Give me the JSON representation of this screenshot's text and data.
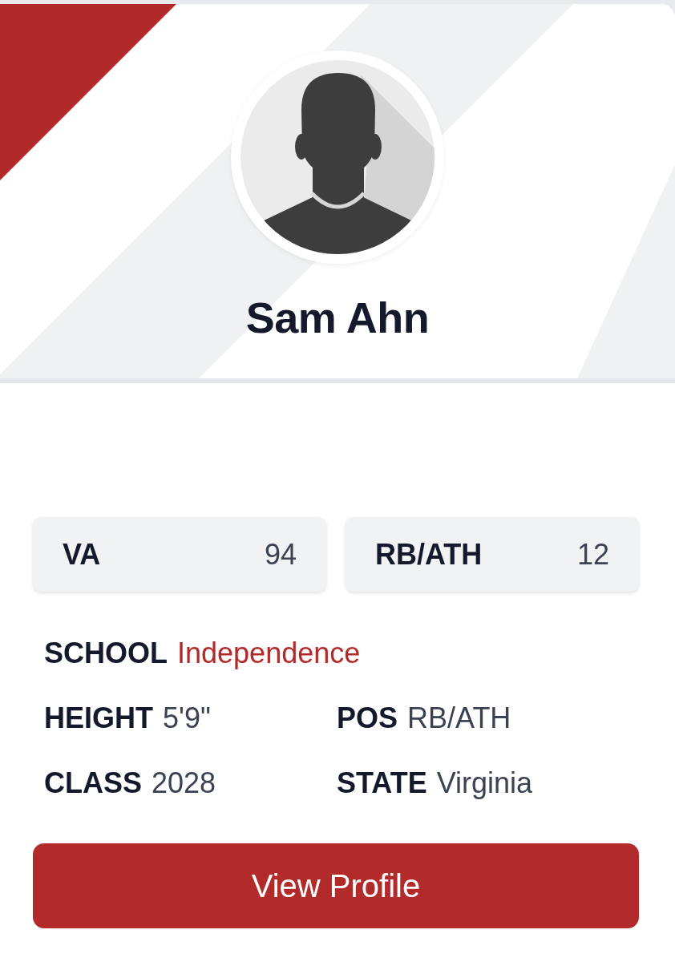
{
  "player": {
    "name": "Sam Ahn"
  },
  "ranks": [
    {
      "label": "VA",
      "value": "94"
    },
    {
      "label": "RB/ATH",
      "value": "12"
    }
  ],
  "detail_rows": [
    [
      {
        "label": "SCHOOL",
        "value": "Independence",
        "kind": "link"
      }
    ],
    [
      {
        "label": "HEIGHT",
        "value": "5'9\"",
        "kind": "text"
      },
      {
        "label": "POS",
        "value": "RB/ATH",
        "kind": "text"
      }
    ],
    [
      {
        "label": "CLASS",
        "value": "2028",
        "kind": "text"
      },
      {
        "label": "STATE",
        "value": "Virginia",
        "kind": "text"
      }
    ]
  ],
  "button": {
    "label": "View Profile"
  }
}
